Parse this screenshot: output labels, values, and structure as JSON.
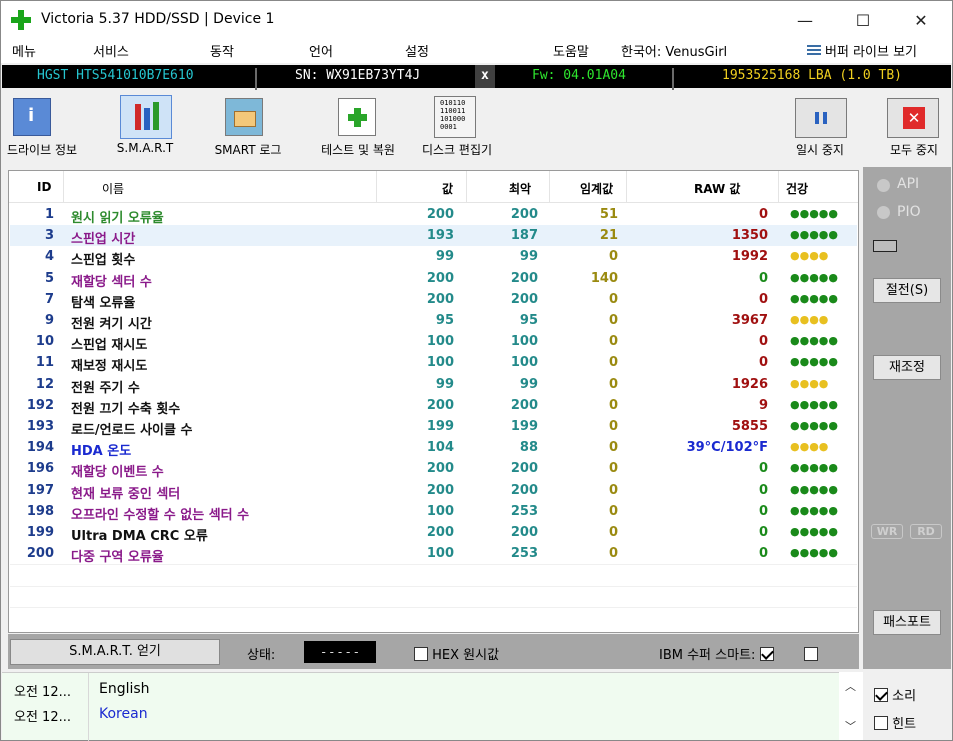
{
  "window": {
    "title": "Victoria 5.37 HDD/SSD | Device 1",
    "minimize": "—",
    "maximize": "☐",
    "close": "✕"
  },
  "menu": {
    "items": [
      "메뉴",
      "서비스",
      "동작",
      "언어",
      "설정",
      "도움말"
    ],
    "lang_user": "한국어: VenusGirl",
    "buffer_drive": "버퍼 라이브 보기"
  },
  "device": {
    "model": "HGST HTS541010B7E610",
    "serial": "SN: WX91EB73YT4J",
    "eject": "x",
    "firmware": "Fw: 04.01A04",
    "lba": "1953525168 LBA (1.0 TB)"
  },
  "toolbar": {
    "drive_info": "드라이브 정보",
    "smart": "S.M.A.R.T",
    "smart_log": "SMART 로그",
    "test_repair": "테스트 및 복원",
    "disk_editor": "디스크 편집기",
    "disk_editor_bits": "010110\n110011\n101000\n0001",
    "pause": "일시 중지",
    "stop_all": "모두 중지"
  },
  "table": {
    "headers": {
      "id": "ID",
      "name": "이름",
      "value": "값",
      "worst": "최악",
      "threshold": "임계값",
      "raw": "RAW 값",
      "health": "건강"
    },
    "rows": [
      {
        "id": "1",
        "name": "원시 읽기 오류율",
        "value": "200",
        "worst": "200",
        "threshold": "51",
        "raw": "0",
        "health": "●●●●●",
        "name_color": "#2e8b2e",
        "thr_color": "#9a8a10",
        "raw_color": "#a01010",
        "health_color": "#1a8a1a"
      },
      {
        "id": "3",
        "name": "스핀업 시간",
        "value": "193",
        "worst": "187",
        "threshold": "21",
        "raw": "1350",
        "health": "●●●●●",
        "name_color": "#8a1a8a",
        "thr_color": "#9a8a10",
        "raw_color": "#a01010",
        "health_color": "#1a8a1a"
      },
      {
        "id": "4",
        "name": "스핀업 횟수",
        "value": "99",
        "worst": "99",
        "threshold": "0",
        "raw": "1992",
        "health": "●●●●",
        "name_color": "#111111",
        "thr_color": "#9a8a10",
        "raw_color": "#a01010",
        "health_color": "#e8c020"
      },
      {
        "id": "5",
        "name": "재할당 섹터 수",
        "value": "200",
        "worst": "200",
        "threshold": "140",
        "raw": "0",
        "health": "●●●●●",
        "name_color": "#8a1a8a",
        "thr_color": "#9a8a10",
        "raw_color": "#1a8a1a",
        "health_color": "#1a8a1a"
      },
      {
        "id": "7",
        "name": "탐색 오류율",
        "value": "200",
        "worst": "200",
        "threshold": "0",
        "raw": "0",
        "health": "●●●●●",
        "name_color": "#111111",
        "thr_color": "#9a8a10",
        "raw_color": "#a01010",
        "health_color": "#1a8a1a"
      },
      {
        "id": "9",
        "name": "전원 켜기 시간",
        "value": "95",
        "worst": "95",
        "threshold": "0",
        "raw": "3967",
        "health": "●●●●",
        "name_color": "#111111",
        "thr_color": "#9a8a10",
        "raw_color": "#a01010",
        "health_color": "#e8c020"
      },
      {
        "id": "10",
        "name": "스핀업 재시도",
        "value": "100",
        "worst": "100",
        "threshold": "0",
        "raw": "0",
        "health": "●●●●●",
        "name_color": "#111111",
        "thr_color": "#9a8a10",
        "raw_color": "#a01010",
        "health_color": "#1a8a1a"
      },
      {
        "id": "11",
        "name": "재보정 재시도",
        "value": "100",
        "worst": "100",
        "threshold": "0",
        "raw": "0",
        "health": "●●●●●",
        "name_color": "#111111",
        "thr_color": "#9a8a10",
        "raw_color": "#a01010",
        "health_color": "#1a8a1a"
      },
      {
        "id": "12",
        "name": "전원 주기 수",
        "value": "99",
        "worst": "99",
        "threshold": "0",
        "raw": "1926",
        "health": "●●●●",
        "name_color": "#111111",
        "thr_color": "#9a8a10",
        "raw_color": "#a01010",
        "health_color": "#e8c020"
      },
      {
        "id": "192",
        "name": "전원 끄기 수축 횟수",
        "value": "200",
        "worst": "200",
        "threshold": "0",
        "raw": "9",
        "health": "●●●●●",
        "name_color": "#111111",
        "thr_color": "#9a8a10",
        "raw_color": "#a01010",
        "health_color": "#1a8a1a"
      },
      {
        "id": "193",
        "name": "로드/언로드 사이클 수",
        "value": "199",
        "worst": "199",
        "threshold": "0",
        "raw": "5855",
        "health": "●●●●●",
        "name_color": "#111111",
        "thr_color": "#9a8a10",
        "raw_color": "#a01010",
        "health_color": "#1a8a1a"
      },
      {
        "id": "194",
        "name": "HDA 온도",
        "value": "104",
        "worst": "88",
        "threshold": "0",
        "raw": "39°C/102°F",
        "health": "●●●●",
        "name_color": "#1a2ad0",
        "thr_color": "#9a8a10",
        "raw_color": "#1a2ad0",
        "health_color": "#e8c020"
      },
      {
        "id": "196",
        "name": "재할당 이벤트 수",
        "value": "200",
        "worst": "200",
        "threshold": "0",
        "raw": "0",
        "health": "●●●●●",
        "name_color": "#8a1a8a",
        "thr_color": "#9a8a10",
        "raw_color": "#1a8a1a",
        "health_color": "#1a8a1a"
      },
      {
        "id": "197",
        "name": "현재 보류 중인 섹터",
        "value": "200",
        "worst": "200",
        "threshold": "0",
        "raw": "0",
        "health": "●●●●●",
        "name_color": "#8a1a8a",
        "thr_color": "#9a8a10",
        "raw_color": "#1a8a1a",
        "health_color": "#1a8a1a"
      },
      {
        "id": "198",
        "name": "오프라인 수정할 수 없는 섹터 수",
        "value": "100",
        "worst": "253",
        "threshold": "0",
        "raw": "0",
        "health": "●●●●●",
        "name_color": "#8a1a8a",
        "thr_color": "#9a8a10",
        "raw_color": "#1a8a1a",
        "health_color": "#1a8a1a"
      },
      {
        "id": "199",
        "name": "Ultra DMA CRC 오류",
        "value": "200",
        "worst": "200",
        "threshold": "0",
        "raw": "0",
        "health": "●●●●●",
        "name_color": "#111111",
        "thr_color": "#9a8a10",
        "raw_color": "#1a8a1a",
        "health_color": "#1a8a1a"
      },
      {
        "id": "200",
        "name": "다중 구역 오류율",
        "value": "100",
        "worst": "253",
        "threshold": "0",
        "raw": "0",
        "health": "●●●●●",
        "name_color": "#8a1a8a",
        "thr_color": "#9a8a10",
        "raw_color": "#1a8a1a",
        "health_color": "#1a8a1a"
      }
    ]
  },
  "bottom": {
    "get_smart": "S.M.A.R.T. 얻기",
    "status_label": "상태:",
    "status_value": "- - - - -",
    "hex_label": "HEX 원시값",
    "ibm_label": "IBM 수퍼 스마트:"
  },
  "side": {
    "api": "API",
    "pio": "PIO",
    "sleep": "절전(S)",
    "reset": "재조정",
    "wr": "WR",
    "rd": "RD",
    "passport": "패스포트"
  },
  "log": {
    "entries": [
      {
        "time": "오전 12...",
        "text": "English",
        "color": "#000000"
      },
      {
        "time": "오전 12...",
        "text": "Korean",
        "color": "#1a2ad0"
      }
    ]
  },
  "options": {
    "sound": "소리",
    "hints": "힌트"
  }
}
